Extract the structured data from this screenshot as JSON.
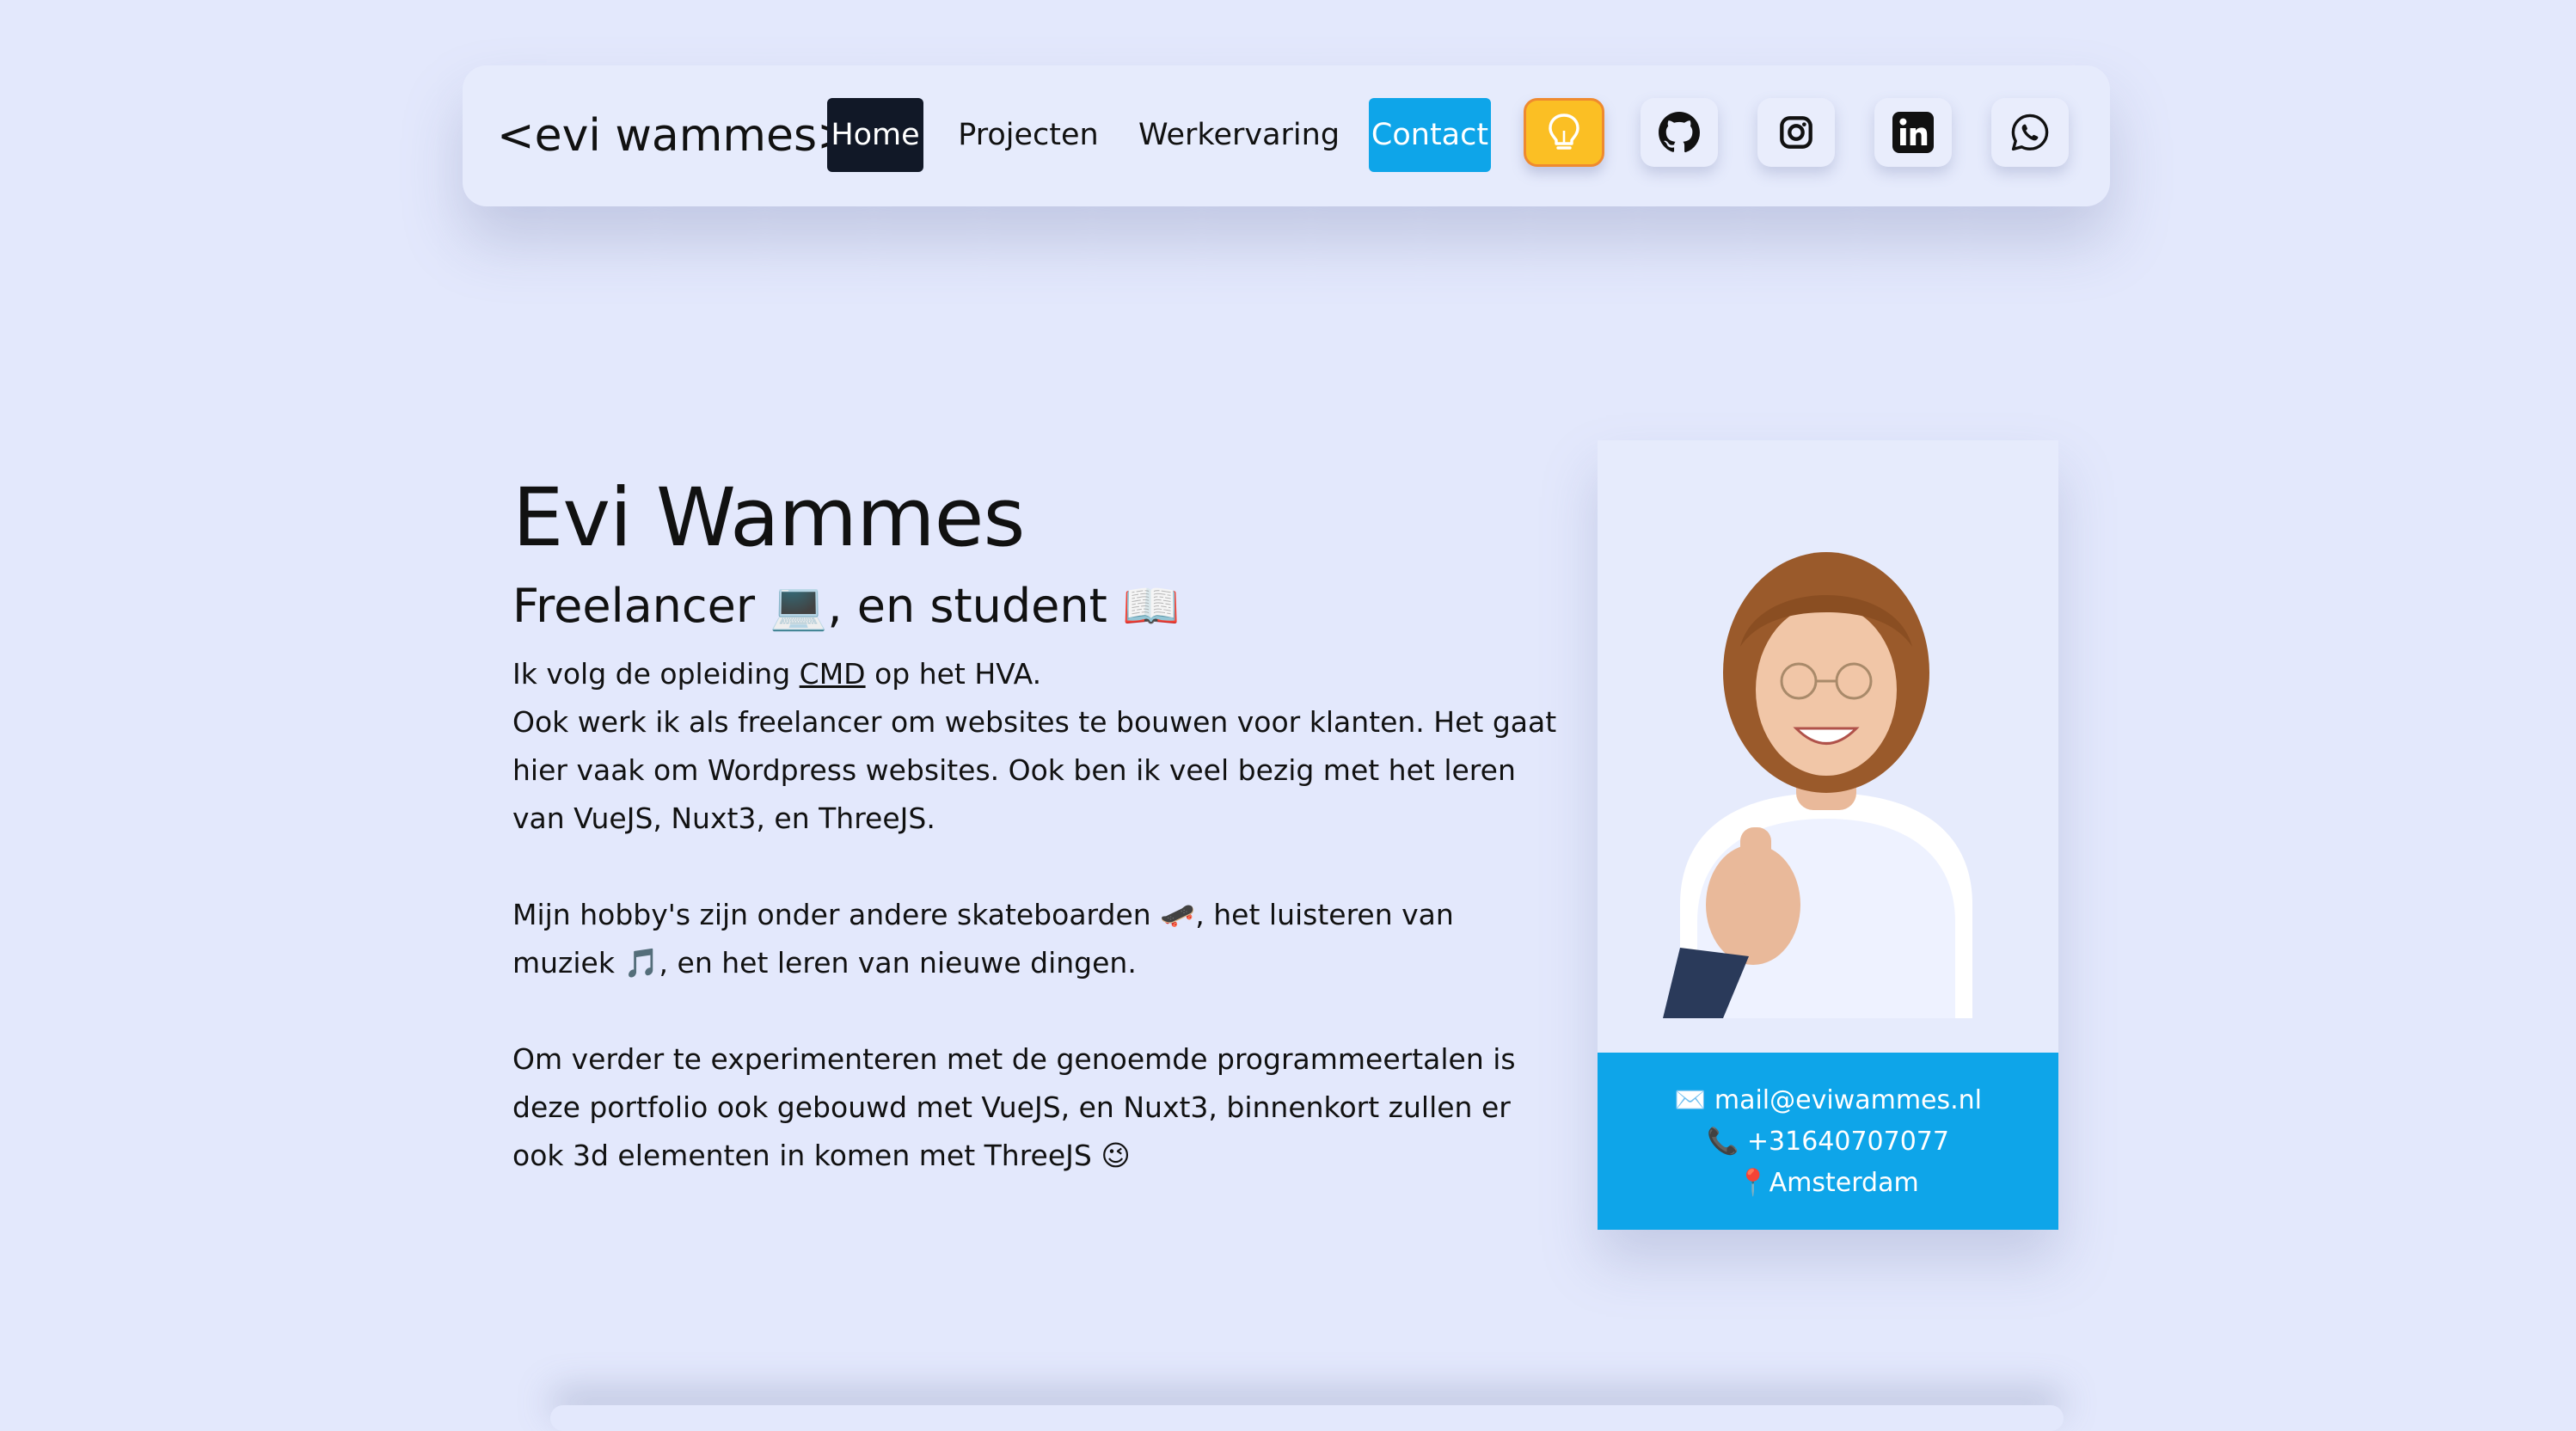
{
  "nav": {
    "logo": "<evi wammes>",
    "links": [
      {
        "label": "Home",
        "active": true
      },
      {
        "label": "Projecten"
      },
      {
        "label": "Werkervaring"
      },
      {
        "label": "Contact",
        "highlight": true
      }
    ],
    "icon_buttons": [
      {
        "icon": "lightbulb-icon",
        "color": "#fbbf24"
      },
      {
        "icon": "github-icon"
      },
      {
        "icon": "instagram-icon"
      },
      {
        "icon": "linkedin-icon"
      },
      {
        "icon": "whatsapp-icon"
      }
    ]
  },
  "hero": {
    "name": "Evi Wammes",
    "tagline": "Freelancer 💻, en student 📖",
    "p1_before_link": "Ik volg de opleiding ",
    "p1_link": "CMD",
    "p1_after_link": " op het HVA.",
    "p1_line2": "Ook werk ik als freelancer om websites te bouwen voor klanten. Het gaat hier vaak om Wordpress websites. Ook ben ik veel bezig met het leren van VueJS, Nuxt3, en ThreeJS.",
    "p2": "Mijn hobby's zijn onder andere skateboarden 🛹, het luisteren van muziek 🎵, en het leren van nieuwe dingen.",
    "p3": "Om verder te experimenteren met de genoemde programmeertalen is deze portfolio ook gebouwd met VueJS, en Nuxt3, binnenkort zullen er ook 3d elementen in komen met ThreeJS 😉"
  },
  "profile_card": {
    "email": "✉️ mail@eviwammes.nl",
    "phone": "📞 +31640707077",
    "location": "📍Amsterdam"
  },
  "colors": {
    "background": "#e3e8fc",
    "accent": "#0ea5e9",
    "dark": "#111827",
    "idea_yellow": "#fbbf24"
  }
}
